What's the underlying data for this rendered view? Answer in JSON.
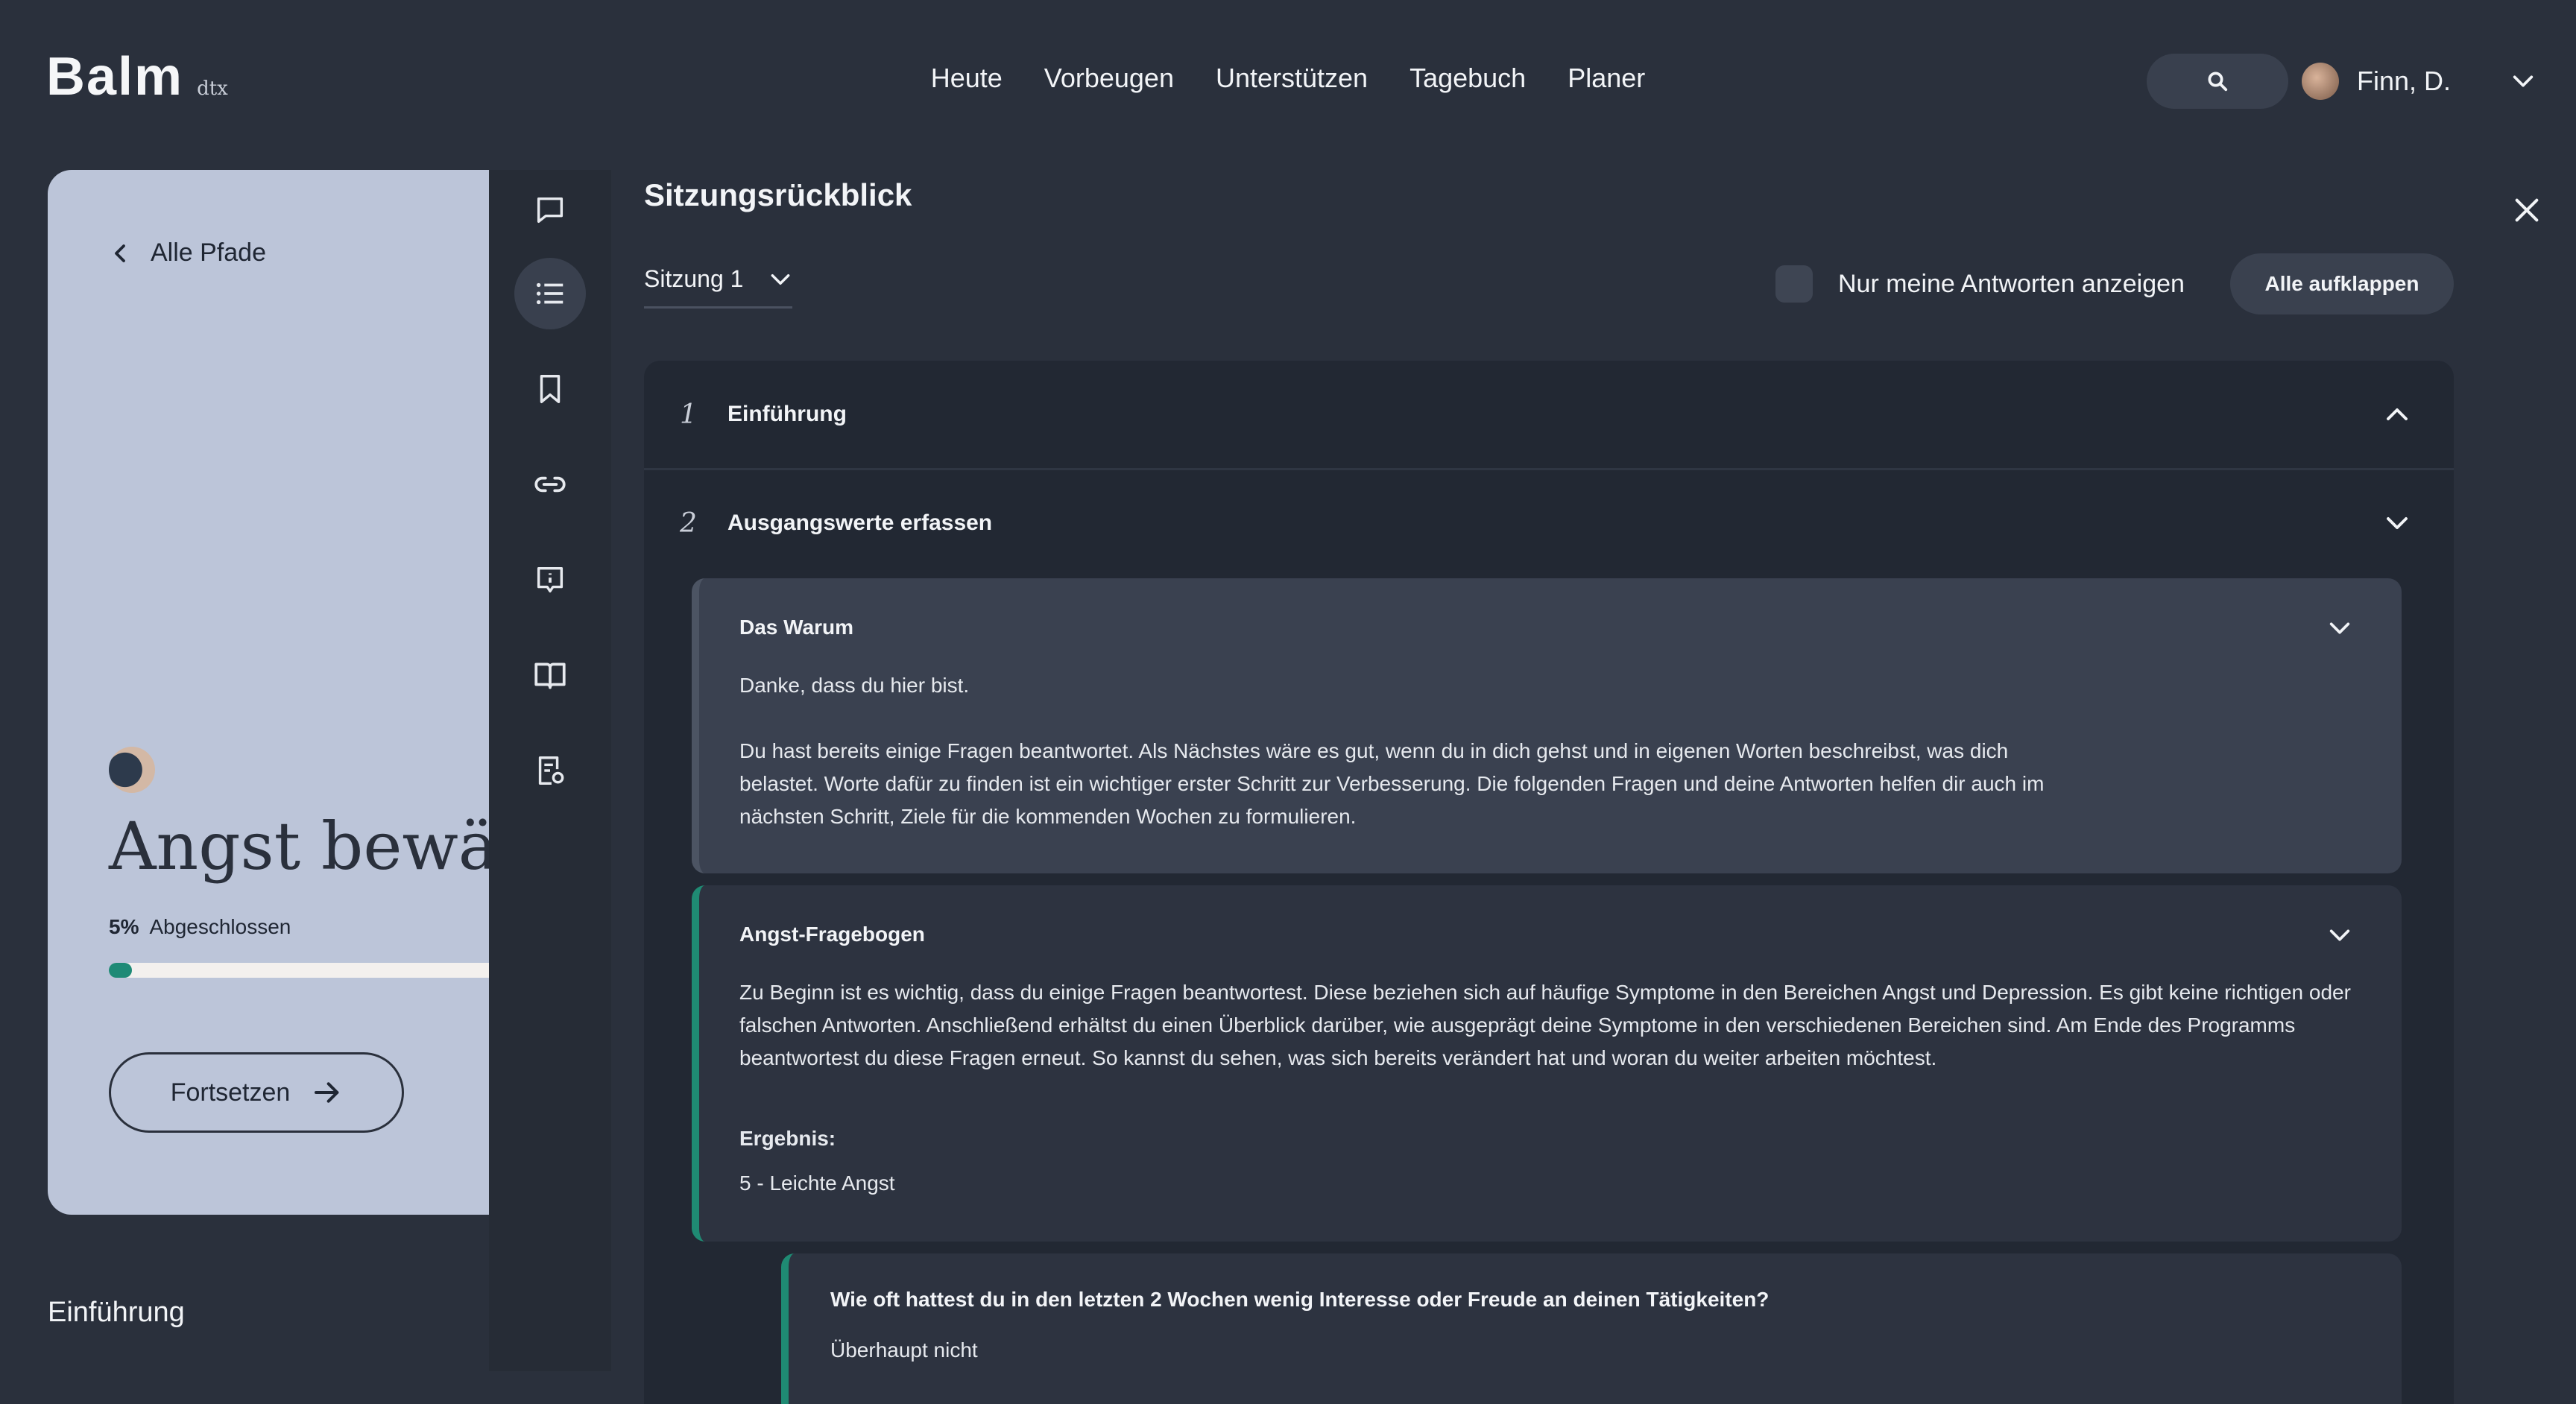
{
  "header": {
    "logo": "Balm",
    "logo_sub": "dtx",
    "nav": [
      "Heute",
      "Vorbeugen",
      "Unterstützen",
      "Tagebuch",
      "Planer"
    ],
    "user_name": "Finn, D."
  },
  "course": {
    "back_label": "Alle Pfade",
    "title": "Angst bewältigen",
    "progress_percent": "5%",
    "progress_value": 0.05,
    "progress_label": "Abgeschlossen",
    "continue_label": "Fortsetzen",
    "section_heading": "Einführung"
  },
  "drawer": {
    "title": "Sitzungsrückblick",
    "session": "Sitzung 1",
    "toggle_label": "Nur meine Antworten anzeigen",
    "expand_all": "Alle aufklappen",
    "sections": [
      {
        "num": "1",
        "title": "Einführung"
      },
      {
        "num": "2",
        "title": "Ausgangswerte erfassen"
      }
    ],
    "why_card": {
      "title": "Das Warum",
      "p1": "Danke, dass du hier bist.",
      "p2_l1": "Du hast bereits einige Fragen beantwortet. Als Nächstes wäre es gut, wenn du in dich gehst und in eigenen Worten beschreibst, was dich",
      "p2_l2": "belastet. Worte dafür zu finden ist ein wichtiger erster Schritt zur Verbesserung. Die folgenden Fragen und deine Antworten helfen dir auch im",
      "p2_l3": "nächsten Schritt, Ziele für die kommenden Wochen zu formulieren."
    },
    "questionnaire": {
      "title": "Angst-Fragebogen",
      "l1": "Zu Beginn ist es wichtig, dass du einige Fragen beantwortest. Diese beziehen sich auf häufige Symptome in den Bereichen Angst und Depression. Es gibt keine richtigen oder",
      "l2": "falschen Antworten. Anschließend erhältst du einen Überblick darüber, wie ausgeprägt deine Symptome in den verschiedenen Bereichen sind. Am Ende des Programms",
      "l3": "beantwortest du diese Fragen erneut. So kannst du sehen, was sich bereits verändert hat und woran du weiter arbeiten möchtest.",
      "result_label": "Ergebnis:",
      "result_value": "5 - Leichte Angst"
    },
    "question": {
      "text": "Wie oft hattest du in den letzten 2 Wochen wenig Interesse oder Freude an deinen Tätigkeiten?",
      "answer": "Überhaupt nicht"
    }
  },
  "colors": {
    "background": "#2a303c",
    "card_accent": "#1f8a73",
    "course_card": "#bcc5d9",
    "progress": "#1e8a76"
  }
}
